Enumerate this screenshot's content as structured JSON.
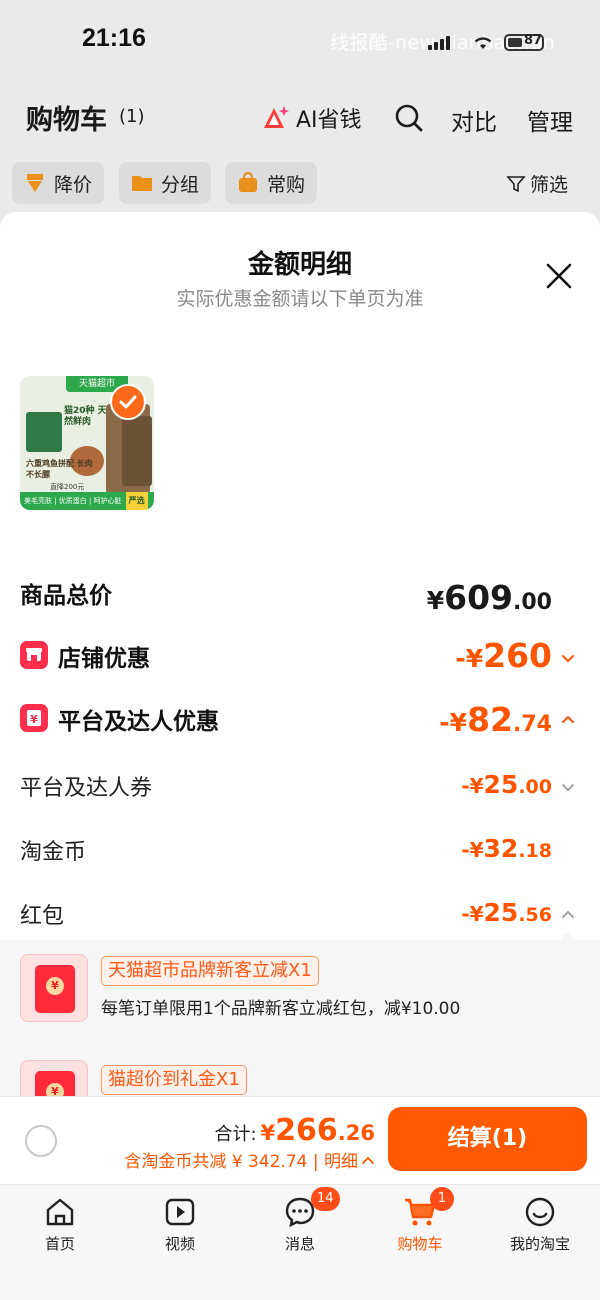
{
  "status_bar": {
    "time": "21:16",
    "battery": "87",
    "watermark": "线报酷-new.xianbao.fun"
  },
  "cart_header": {
    "title": "购物车",
    "count": "(1)",
    "ai_label": "AI省钱",
    "compare": "对比",
    "manage": "管理"
  },
  "filters": {
    "price_drop": "降价",
    "group": "分组",
    "frequent": "常购",
    "filter": "筛选"
  },
  "sheet": {
    "title": "金额明细",
    "subtitle": "实际优惠金额请以下单页为准",
    "thumb": {
      "store_tag": "天猫超市",
      "headline": "猫20种 天然鲜肉",
      "tagline": "六重鸡鱼拼配 长肉不长膘",
      "price_note": "直降200元",
      "strip": "美毛亮肤 | 优质蛋白 | 呵护心脏",
      "strip_badge": "严选"
    }
  },
  "breakdown": {
    "total": {
      "label": "商品总价",
      "symbol": "¥",
      "int": "609",
      "dec": ".00"
    },
    "store_discount": {
      "label": "店铺优惠",
      "symbol": "-¥",
      "int": "260",
      "dec": ""
    },
    "platform_discount": {
      "label": "平台及达人优惠",
      "symbol": "-¥",
      "int": "82",
      "dec": ".74"
    },
    "platform_coupon": {
      "label": "平台及达人券",
      "symbol": "-¥",
      "int": "25",
      "dec": ".00"
    },
    "taojinbi": {
      "label": "淘金币",
      "symbol": "-¥",
      "int": "32",
      "dec": ".18"
    },
    "red_packet": {
      "label": "红包",
      "symbol": "-¥",
      "int": "25",
      "dec": ".56"
    }
  },
  "red_packets": [
    {
      "tag": "天猫超市品牌新客立减X1",
      "desc": "每笔订单限用1个品牌新客立减红包，减¥10.00"
    },
    {
      "tag": "猫超价到礼金X1",
      "desc": ""
    }
  ],
  "checkout": {
    "total_label": "合计:",
    "total_symbol": "¥",
    "total_int": "266",
    "total_dec": ".26",
    "saving_text": "含淘金币共减 ¥ 342.74 | 明细",
    "button": "结算(1)"
  },
  "tabs": [
    {
      "label": "首页",
      "icon": "home-icon"
    },
    {
      "label": "视频",
      "icon": "video-icon"
    },
    {
      "label": "消息",
      "icon": "message-icon",
      "badge": "14"
    },
    {
      "label": "购物车",
      "icon": "cart-icon",
      "badge": "1"
    },
    {
      "label": "我的淘宝",
      "icon": "profile-icon"
    }
  ],
  "colors": {
    "accent": "#ff5500",
    "red_icon": "#ff2e4d",
    "checkout_button": "#ff5a00"
  }
}
